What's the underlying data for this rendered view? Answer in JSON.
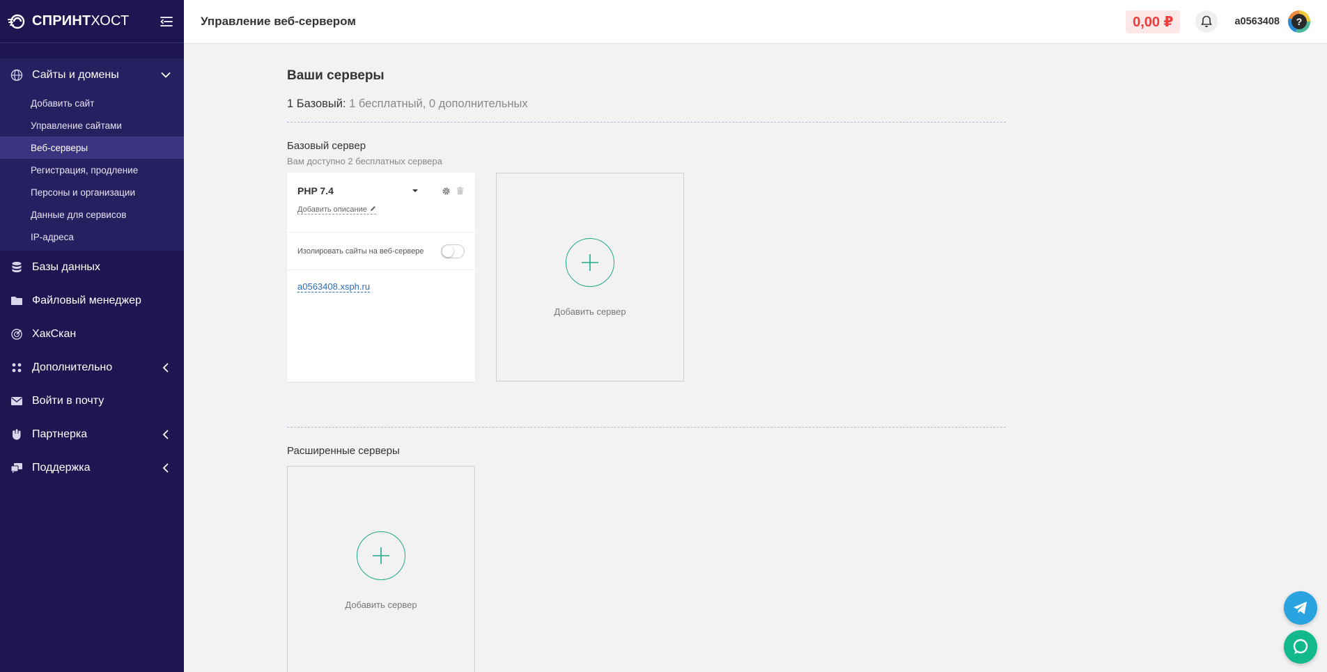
{
  "brand": {
    "name_bold": "спринт",
    "name_regular": "хост",
    "logo_icon": "sprinthost-logo-icon",
    "menu_icon": "menu-collapse-icon"
  },
  "sidebar": {
    "groups": [
      {
        "label": "Сайты и домены",
        "icon": "globe-icon",
        "expanded": true,
        "items": [
          {
            "label": "Добавить сайт",
            "active": false
          },
          {
            "label": "Управление сайтами",
            "active": false
          },
          {
            "label": "Веб-серверы",
            "active": true
          },
          {
            "label": "Регистрация, продление",
            "active": false
          },
          {
            "label": "Персоны и организации",
            "active": false
          },
          {
            "label": "Данные для сервисов",
            "active": false
          },
          {
            "label": "IP-адреса",
            "active": false
          }
        ]
      }
    ],
    "items": [
      {
        "label": "Базы данных",
        "icon": "database-icon"
      },
      {
        "label": "Файловый менеджер",
        "icon": "folder-icon"
      },
      {
        "label": "ХакСкан",
        "icon": "radar-icon"
      },
      {
        "label": "Дополнительно",
        "icon": "grid-dots-icon",
        "has_submenu": true
      },
      {
        "label": "Войти в почту",
        "icon": "mail-icon"
      },
      {
        "label": "Партнерка",
        "icon": "handshake-icon",
        "has_submenu": true
      },
      {
        "label": "Поддержка",
        "icon": "support-chat-icon",
        "has_submenu": true
      }
    ]
  },
  "header": {
    "title": "Управление веб-сервером",
    "balance": "0,00 ₽",
    "username": "a0563408",
    "avatar_text": "?"
  },
  "main": {
    "servers_title": "Ваши серверы",
    "summary_lead": "1 Базовый:",
    "summary_detail": "1 бесплатный, 0 дополнительных",
    "basic": {
      "title": "Базовый сервер",
      "note": "Вам доступно 2 бесплатных сервера",
      "server": {
        "php": "PHP 7.4",
        "description_link": "Добавить описание",
        "isolate_label": "Изолировать сайты на веб-сервере",
        "isolate_enabled": false,
        "site": "a0563408.xsph.ru"
      },
      "add_label": "Добавить сервер"
    },
    "extended": {
      "title": "Расширенные серверы",
      "add_label": "Добавить сервер"
    }
  },
  "colors": {
    "sidebar_bg": "#1d1650",
    "active_item_bg": "#3c3481",
    "accent_green": "#1ea88a",
    "balance_red": "#ef3b3b",
    "link_blue": "#2b6db6"
  }
}
